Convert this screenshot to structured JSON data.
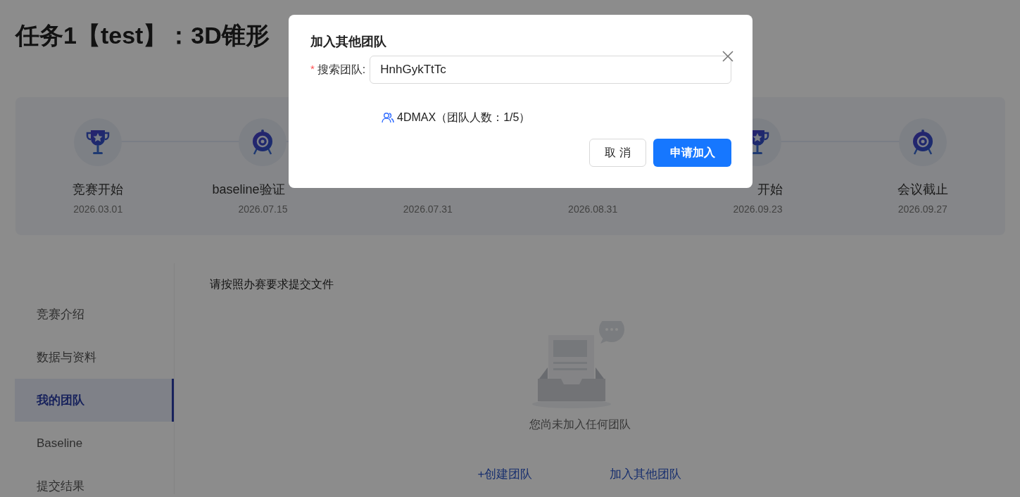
{
  "page_title": "任务1【test】：3D锥形",
  "milestones": [
    {
      "kind": "trophy",
      "label": "竞赛开始",
      "date": "2026.03.01"
    },
    {
      "kind": "target",
      "label": "baseline验证",
      "cut_at_end": true,
      "date": "2026.07.15"
    },
    {
      "date": "2026.07.31"
    },
    {
      "date": "2026.08.31"
    },
    {
      "kind": "trophy",
      "label": "开始",
      "cut_at_start": true,
      "date": "2026.09.23"
    },
    {
      "kind": "target",
      "label": "会议截止",
      "date": "2026.09.27"
    }
  ],
  "sidebar": {
    "items": [
      {
        "label": "竞赛介绍",
        "selected": false
      },
      {
        "label": "数据与资料",
        "selected": false
      },
      {
        "label": "我的团队",
        "selected": true
      },
      {
        "label": "Baseline",
        "selected": false
      },
      {
        "label": "提交结果",
        "selected": false
      }
    ]
  },
  "content": {
    "heading": "请按照办赛要求提交文件",
    "empty_text": "您尚未加入任何团队",
    "links": [
      "+创建团队",
      "加入其他团队"
    ]
  },
  "dialog": {
    "title": "加入其他团队",
    "required_mark": "*",
    "field_label": "搜索团队:",
    "field_value": "HnhGykTtTc",
    "result": "4DMAX（团队人数：1/5）",
    "buttons": [
      {
        "kind": "default",
        "label": "取 消"
      },
      {
        "kind": "primary",
        "label": "申请加入"
      }
    ]
  }
}
